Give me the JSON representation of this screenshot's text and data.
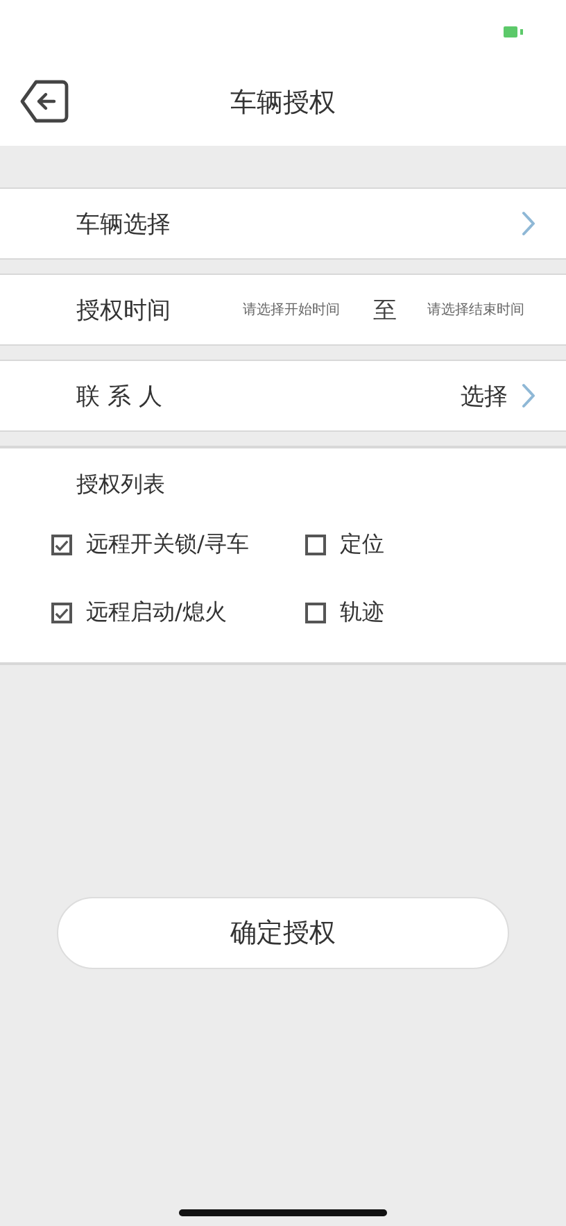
{
  "header": {
    "title": "车辆授权"
  },
  "rows": [
    {
      "kind": "select",
      "label": "车辆选择"
    },
    {
      "kind": "time",
      "label": "授权时间",
      "start_placeholder": "请选择开始时间",
      "separator": "至",
      "end_placeholder": "请选择结束时间"
    },
    {
      "kind": "select",
      "label": "联 系 人",
      "value": "选择"
    }
  ],
  "permissions": {
    "title": "授权列表",
    "items": [
      {
        "label": "远程开关锁/寻车",
        "checked": true
      },
      {
        "label": "定位",
        "checked": false
      },
      {
        "label": "远程启动/熄火",
        "checked": true
      },
      {
        "label": "轨迹",
        "checked": false
      }
    ]
  },
  "submit_button": "确定授权"
}
